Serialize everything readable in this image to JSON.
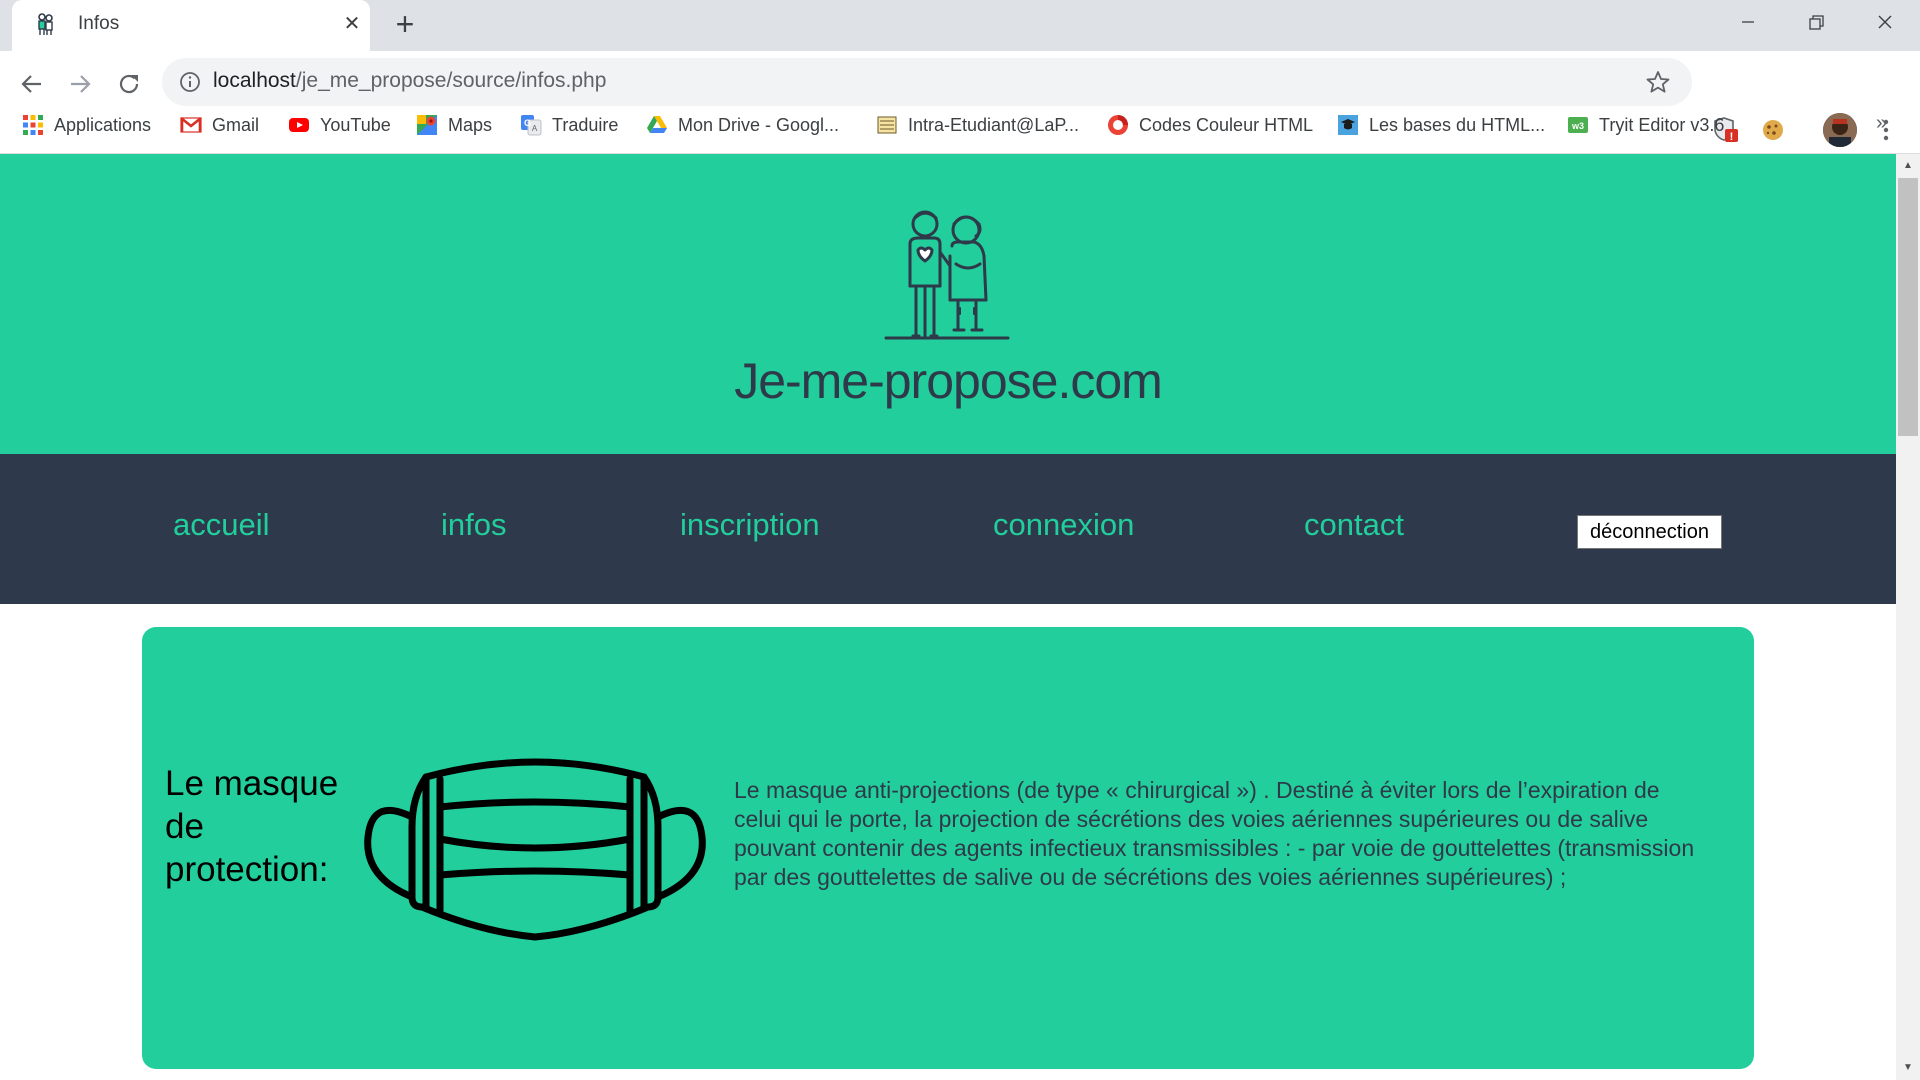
{
  "browser": {
    "tab_title": "Infos",
    "url_host": "localhost",
    "url_path": "/je_me_propose/source/infos.php",
    "bookmarks": [
      {
        "label": "Applications",
        "icon": "apps-grid-icon"
      },
      {
        "label": "Gmail",
        "icon": "gmail-icon"
      },
      {
        "label": "YouTube",
        "icon": "youtube-icon"
      },
      {
        "label": "Maps",
        "icon": "maps-icon"
      },
      {
        "label": "Traduire",
        "icon": "translate-icon"
      },
      {
        "label": "Mon Drive - Googl...",
        "icon": "drive-icon"
      },
      {
        "label": "Intra-Etudiant@LaP...",
        "icon": "intra-icon"
      },
      {
        "label": "Codes Couleur HTML",
        "icon": "color-codes-icon"
      },
      {
        "label": "Les bases du HTML...",
        "icon": "html-bases-icon"
      },
      {
        "label": "Tryit Editor v3.6",
        "icon": "w3schools-icon"
      }
    ],
    "bookmarks_overflow": "»"
  },
  "site": {
    "title": "Je-me-propose.com",
    "nav": [
      {
        "label": "accueil"
      },
      {
        "label": "infos"
      },
      {
        "label": "inscription"
      },
      {
        "label": "connexion"
      },
      {
        "label": "contact"
      }
    ],
    "logout_label": "déconnection"
  },
  "card": {
    "title": "Le masque de protection:",
    "text": "Le masque anti-projections (de type « chirurgical ») . Destiné à éviter lors de l’expiration de celui qui le porte, la projection de sécrétions des voies aériennes supérieures ou de salive pouvant contenir des agents infectieux transmissibles : - par voie de gouttelettes (transmission par des gouttelettes de salive ou de sécrétions des voies aériennes supérieures) ;"
  },
  "colors": {
    "brand_green": "#22ce9b",
    "nav_dark": "#2e3a4c",
    "title_dark": "#2e3a4a"
  }
}
